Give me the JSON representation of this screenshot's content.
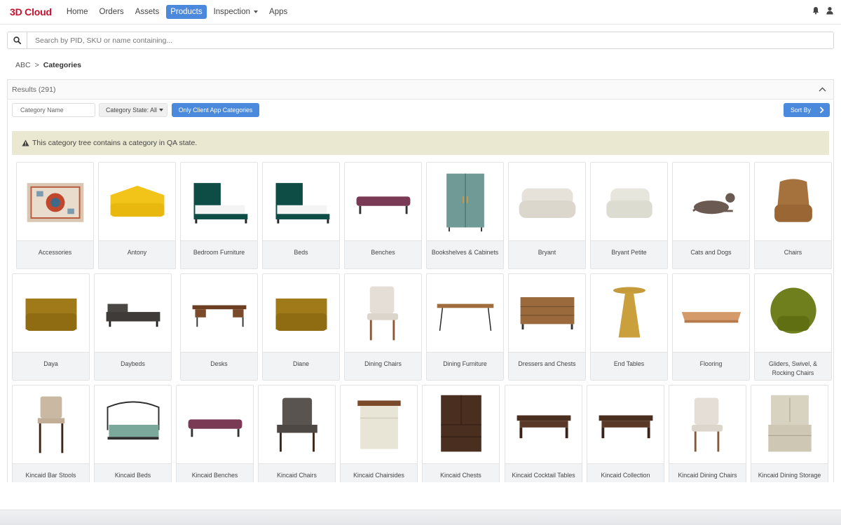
{
  "nav": {
    "brand": "3D Cloud",
    "items": [
      {
        "label": "Home",
        "active": false
      },
      {
        "label": "Orders",
        "active": false
      },
      {
        "label": "Assets",
        "active": false
      },
      {
        "label": "Products",
        "active": true
      },
      {
        "label": "Inspection",
        "active": false,
        "dropdown": true
      },
      {
        "label": "Apps",
        "active": false
      }
    ],
    "icons": [
      "bell-icon",
      "user-icon"
    ]
  },
  "search": {
    "placeholder": "Search by PID, SKU or name containing...",
    "icon": "search-icon"
  },
  "breadcrumb": {
    "root": "ABC",
    "separator": ">",
    "current": "Categories"
  },
  "results": {
    "header": "Results (291)"
  },
  "filters": {
    "category_name_placeholder": "Category Name",
    "category_state": "Category State: All",
    "only_client_app": "Only Client App Categories",
    "sort_by": "Sort By"
  },
  "alert": {
    "text": "This category tree contains a category in QA state.",
    "icon": "warning-icon"
  },
  "colors": {
    "brand": "#c8102e",
    "accent": "#4a89dc",
    "alert_bg": "#ebe8d2"
  },
  "categories": [
    {
      "label": "Accessories",
      "icon": "rug-icon"
    },
    {
      "label": "Antony",
      "icon": "corner-sofa-icon"
    },
    {
      "label": "Bedroom Furniture",
      "icon": "bed-icon"
    },
    {
      "label": "Beds",
      "icon": "bed-icon"
    },
    {
      "label": "Benches",
      "icon": "bench-icon"
    },
    {
      "label": "Bookshelves & Cabinets",
      "icon": "cabinet-icon"
    },
    {
      "label": "Bryant",
      "icon": "sofa-icon"
    },
    {
      "label": "Bryant Petite",
      "icon": "armchair-icon"
    },
    {
      "label": "Cats and Dogs",
      "icon": "dog-icon"
    },
    {
      "label": "Chairs",
      "icon": "lounge-chair-icon"
    },
    {
      "label": "Daya",
      "icon": "corner-chair-icon"
    },
    {
      "label": "Daybeds",
      "icon": "daybed-icon"
    },
    {
      "label": "Desks",
      "icon": "desk-icon"
    },
    {
      "label": "Diane",
      "icon": "corner-chair-icon"
    },
    {
      "label": "Dining Chairs",
      "icon": "dining-chair-icon"
    },
    {
      "label": "Dining Furniture",
      "icon": "table-icon"
    },
    {
      "label": "Dressers and Chests",
      "icon": "dresser-icon"
    },
    {
      "label": "End Tables",
      "icon": "end-table-icon"
    },
    {
      "label": "Flooring",
      "icon": "flooring-icon"
    },
    {
      "label": "Gliders, Swivel, & Rocking Chairs",
      "icon": "swivel-chair-icon"
    },
    {
      "label": "Kincaid Bar Stools",
      "icon": "bar-stool-icon"
    },
    {
      "label": "Kincaid Beds",
      "icon": "iron-bed-icon"
    },
    {
      "label": "Kincaid Benches",
      "icon": "bench-icon"
    },
    {
      "label": "Kincaid Chairs",
      "icon": "arm-chair-icon"
    },
    {
      "label": "Kincaid Chairsides",
      "icon": "nightstand-icon"
    },
    {
      "label": "Kincaid Chests",
      "icon": "chest-icon"
    },
    {
      "label": "Kincaid Cocktail Tables",
      "icon": "coffee-table-icon"
    },
    {
      "label": "Kincaid Collection",
      "icon": "coffee-table-icon"
    },
    {
      "label": "Kincaid Dining Chairs",
      "icon": "dining-chair-icon"
    },
    {
      "label": "Kincaid Dining Storage",
      "icon": "hutch-icon"
    }
  ]
}
